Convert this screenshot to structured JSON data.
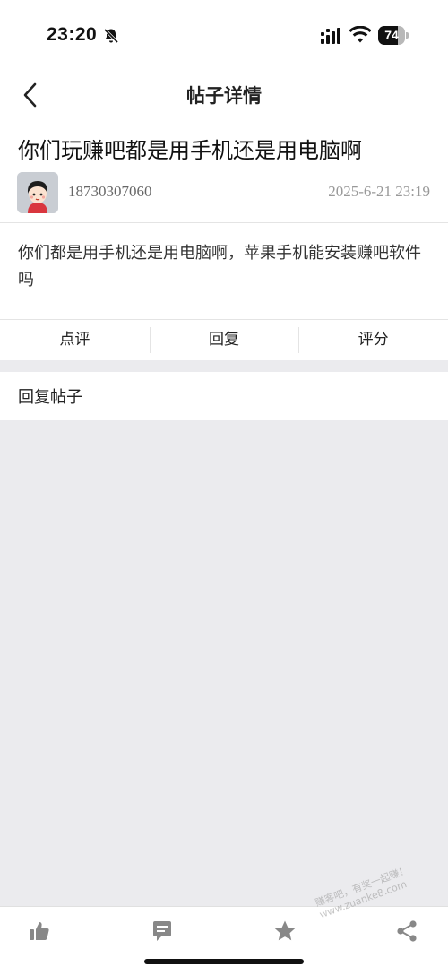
{
  "status_bar": {
    "time": "23:20",
    "battery_level": "74",
    "battery_percent": 74,
    "icons": [
      "bell-slash-icon",
      "signal-icon",
      "wifi-icon",
      "battery-icon"
    ]
  },
  "nav": {
    "title": "帖子详情",
    "back_icon": "chevron-left-icon"
  },
  "post": {
    "title": "你们玩赚吧都是用手机还是用电脑啊",
    "author": "18730307060",
    "time": "2025-6-21 23:19",
    "content": "你们都是用手机还是用电脑啊，苹果手机能安装赚吧软件吗"
  },
  "actions": {
    "comment_label": "点评",
    "reply_label": "回复",
    "rate_label": "评分"
  },
  "reply_section": {
    "label": "回复帖子"
  },
  "bottom_bar": {
    "icons": [
      "thumbs-up-icon",
      "comment-icon",
      "star-icon",
      "share-icon"
    ]
  },
  "watermark": {
    "line1": "赚客吧，有奖一起赚！",
    "line2": "www.zuanke8.com"
  },
  "colors": {
    "background": "#ebebee",
    "card": "#ffffff",
    "muted_text": "#999999",
    "icon_gray": "#888888"
  }
}
